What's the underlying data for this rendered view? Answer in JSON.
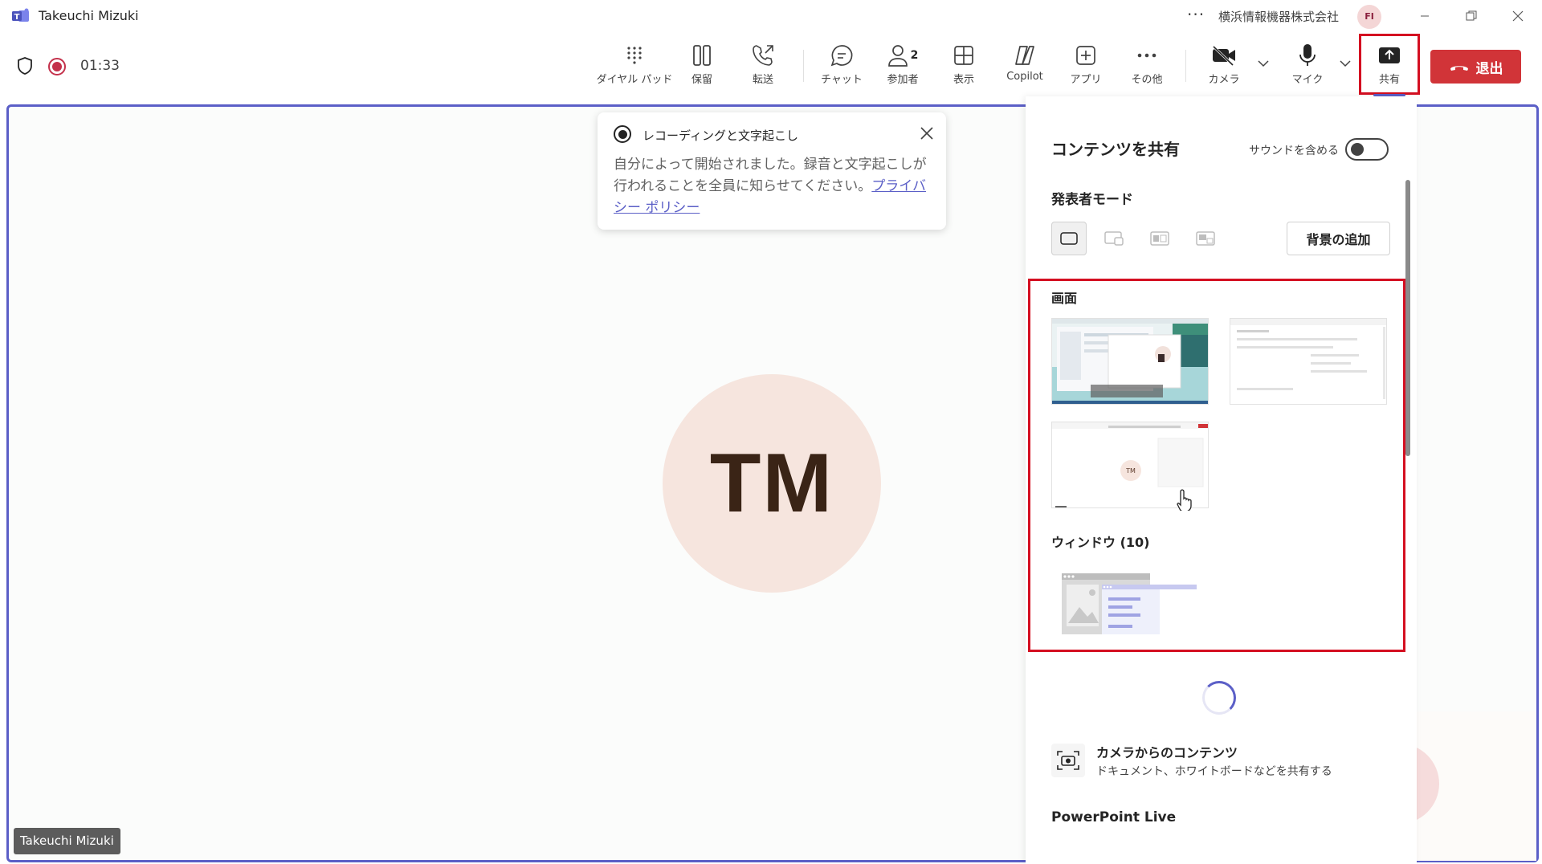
{
  "titlebar": {
    "window_title": "Takeuchi Mizuki",
    "more": "···",
    "org_name": "横浜情報機器株式会社",
    "org_initials": "FI"
  },
  "call": {
    "timer": "01:33",
    "toolbar": [
      {
        "label": "ダイヤル パッド",
        "icon": "dialpad-icon"
      },
      {
        "label": "保留",
        "icon": "hold-icon"
      },
      {
        "label": "転送",
        "icon": "transfer-icon"
      },
      {
        "label": "チャット",
        "icon": "chat-icon"
      },
      {
        "label": "参加者",
        "icon": "people-icon",
        "count": "2"
      },
      {
        "label": "表示",
        "icon": "view-icon"
      },
      {
        "label": "Copilot",
        "icon": "copilot-icon"
      },
      {
        "label": "アプリ",
        "icon": "apps-icon"
      },
      {
        "label": "その他",
        "icon": "more-icon"
      },
      {
        "label": "カメラ",
        "icon": "camera-off-icon"
      },
      {
        "label": "マイク",
        "icon": "mic-icon"
      },
      {
        "label": "共有",
        "icon": "share-icon"
      }
    ],
    "leave_label": "退出"
  },
  "stage": {
    "avatar_initials": "TM",
    "name_tag": "Takeuchi Mizuki",
    "thumb_initials": "TM"
  },
  "recording_popup": {
    "title": "レコーディングと文字起こし",
    "body": "自分によって開始されました。録音と文字起こしが行われることを全員に知らせてください。",
    "link": "プライバシー ポリシー"
  },
  "share_panel": {
    "title": "コンテンツを共有",
    "sound_label": "サウンドを含める",
    "sound_enabled": false,
    "presenter_mode_title": "発表者モード",
    "background_button": "背景の追加",
    "screens_title": "画面",
    "windows_title": "ウィンドウ (10)",
    "camera_title": "カメラからのコンテンツ",
    "camera_sub": "ドキュメント、ホワイトボードなどを共有する",
    "ppt_live": "PowerPoint Live"
  },
  "colors": {
    "accent": "#5b5fc7",
    "leave": "#d13438",
    "highlight": "#d40f21"
  }
}
